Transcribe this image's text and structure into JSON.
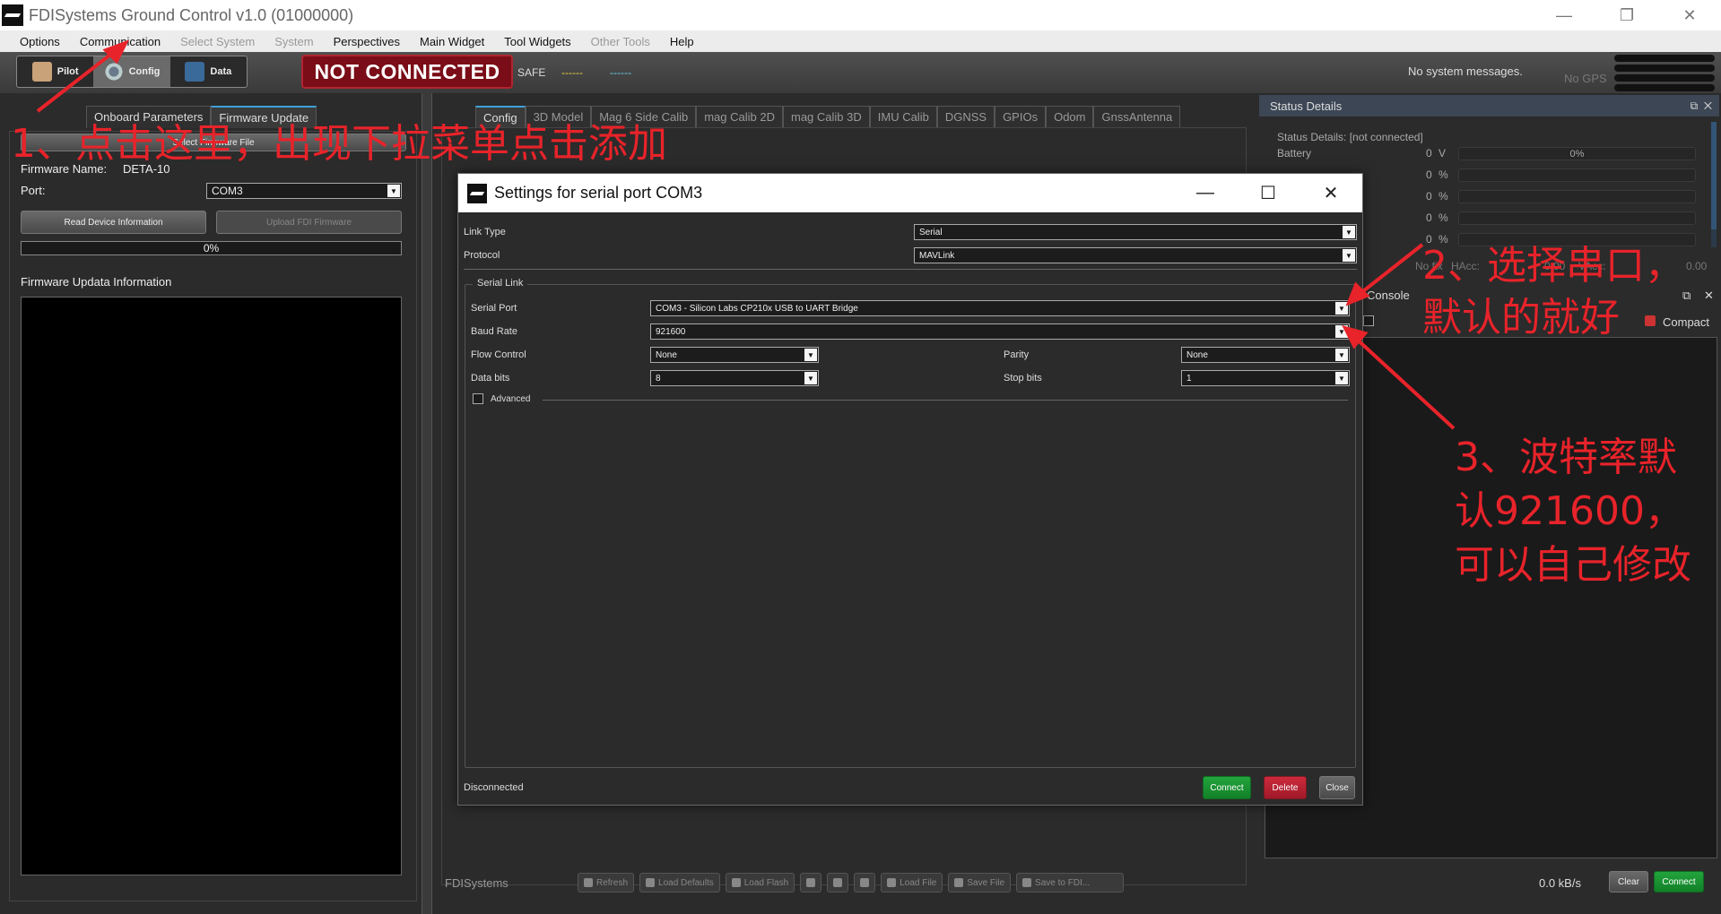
{
  "window": {
    "title": "FDISystems Ground Control v1.0 (01000000)",
    "min": "—",
    "max": "❐",
    "close": "✕"
  },
  "menu": [
    {
      "label": "Options",
      "disabled": false
    },
    {
      "label": "Communication",
      "disabled": false
    },
    {
      "label": "Select System",
      "disabled": true
    },
    {
      "label": "System",
      "disabled": true
    },
    {
      "label": "Perspectives",
      "disabled": false
    },
    {
      "label": "Main Widget",
      "disabled": false
    },
    {
      "label": "Tool Widgets",
      "disabled": false
    },
    {
      "label": "Other Tools",
      "disabled": true
    },
    {
      "label": "Help",
      "disabled": false
    }
  ],
  "toolbar": {
    "modes": [
      "Pilot",
      "Config",
      "Data"
    ],
    "status": "NOT CONNECTED",
    "safe": "SAFE",
    "dash1": "------",
    "dash2": "------",
    "sysmsg": "No system messages.",
    "gps": "No GPS"
  },
  "left": {
    "tabs": [
      "Onboard Parameters",
      "Firmware Update"
    ],
    "select_file": "Select Firmware File",
    "fw_name_label": "Firmware Name:",
    "fw_name": "DETA-10",
    "port_label": "Port:",
    "port": "COM3",
    "read_btn": "Read Device Information",
    "upload_btn": "Upload FDI Firmware",
    "progress": "0%",
    "info_title": "Firmware Updata Information"
  },
  "center": {
    "tabs": [
      "Config",
      "3D Model",
      "Mag 6 Side Calib",
      "mag Calib 2D",
      "mag Calib 3D",
      "IMU Calib",
      "DGNSS",
      "GPIOs",
      "Odom",
      "GnssAntenna"
    ],
    "brand": "FDISystems",
    "buttons": [
      "Refresh",
      "Load Defaults",
      "Load Flash",
      "",
      "",
      "",
      "Load File",
      "Save File",
      "Save to FDI..."
    ]
  },
  "right": {
    "status_title": "Status Details",
    "status_line": "Status Details: [not connected]",
    "battery_label": "Battery",
    "rows": [
      {
        "val": "0",
        "unit": "V",
        "bar": "0%"
      },
      {
        "val": "0",
        "unit": "%",
        "bar": ""
      },
      {
        "val": "0",
        "unit": "%",
        "bar": ""
      },
      {
        "val": "0",
        "unit": "%",
        "bar": ""
      },
      {
        "val": "0",
        "unit": "%",
        "bar": ""
      }
    ],
    "nofix": "No fix",
    "hacc": "HAcc:",
    "hacc_val": "0.00",
    "vacc": "VAcc:",
    "vacc_val": "0.00",
    "console_title": "Console",
    "compact": "Compact",
    "rate": "0.0 kB/s",
    "clear": "Clear",
    "connect": "Connect"
  },
  "dialog": {
    "title": "Settings for serial port COM3",
    "link_type_label": "Link Type",
    "link_type": "Serial",
    "protocol_label": "Protocol",
    "protocol": "MAVLink",
    "group": "Serial Link",
    "serial_port_label": "Serial Port",
    "serial_port": "COM3 - Silicon Labs CP210x USB to UART Bridge",
    "baud_label": "Baud Rate",
    "baud": "921600",
    "flow_label": "Flow Control",
    "flow": "None",
    "parity_label": "Parity",
    "parity": "None",
    "databits_label": "Data bits",
    "databits": "8",
    "stopbits_label": "Stop bits",
    "stopbits": "1",
    "advanced": "Advanced",
    "status": "Disconnected",
    "connect": "Connect",
    "delete": "Delete",
    "close": "Close"
  },
  "annotations": {
    "a1": "1、点击这里，出现下拉菜单点击添加",
    "a2_l1": "2、选择串口，",
    "a2_l2": "默认的就好",
    "a3_l1": "3、波特率默",
    "a3_l2": "认921600，",
    "a3_l3": "可以自己修改"
  }
}
